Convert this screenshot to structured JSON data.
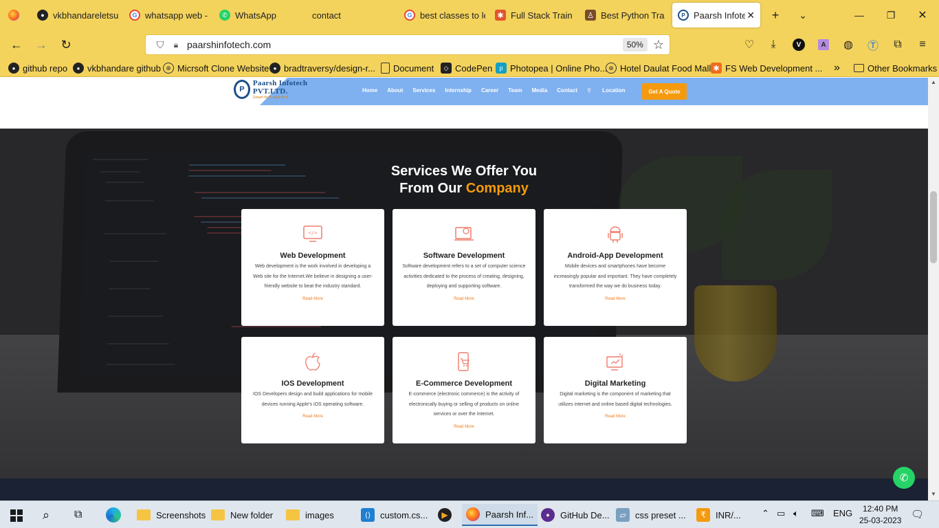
{
  "tabs": [
    {
      "label": "vkbhandareletsup",
      "icon": "github-icon"
    },
    {
      "label": "whatsapp web - G",
      "icon": "google-icon"
    },
    {
      "label": "WhatsApp",
      "icon": "whatsapp-icon"
    },
    {
      "label": "contact",
      "icon": "none"
    },
    {
      "label": "best classes to le",
      "icon": "google-icon"
    },
    {
      "label": "Full Stack Trainin",
      "icon": "fullstack-icon"
    },
    {
      "label": "Best Python Train",
      "icon": "python-icon"
    },
    {
      "label": "Paarsh Infotech",
      "icon": "paarsh-icon"
    }
  ],
  "toolbar": {
    "url": "paarshinfotech.com",
    "zoom": "50%",
    "profile_initial": "V",
    "ext_initial": "A"
  },
  "bookmarks": [
    {
      "label": "github repo",
      "icon": "github-icon"
    },
    {
      "label": "vkbhandare github",
      "icon": "github-icon"
    },
    {
      "label": "Micrsoft Clone Website",
      "icon": "globe-icon"
    },
    {
      "label": "bradtraversy/design-r...",
      "icon": "github-icon"
    },
    {
      "label": "Document",
      "icon": "document-icon"
    },
    {
      "label": "CodePen",
      "icon": "codepen-icon"
    },
    {
      "label": "Photopea | Online Pho...",
      "icon": "photopea-icon"
    },
    {
      "label": "Hotel Daulat Food Mall",
      "icon": "globe-icon"
    },
    {
      "label": "FS Web Development ...",
      "icon": "fs-icon"
    }
  ],
  "other_bookmarks": "Other Bookmarks",
  "site": {
    "logo_name": "Paarsh Infotech PVT.LTD.",
    "logo_tag": "Dream for it, work for it...",
    "menu": [
      "Home",
      "About",
      "Services",
      "Internship",
      "Career",
      "Team",
      "Media",
      "Contact",
      "Location"
    ],
    "quote_button": "Get A Quote"
  },
  "services": {
    "title_line1": "Services We Offer You",
    "title_prefix": "From Our ",
    "title_highlight": "Company",
    "cards": [
      {
        "title": "Web Development",
        "desc": "Web development is the work involved in developing a Web site for the Internet.We believe in designing a user-friendly website to beat the industry standard.",
        "link": "Read More",
        "icon": "web-code-icon"
      },
      {
        "title": "Software Development",
        "desc": "Software development refers to a set of computer science activities dedicated to the process of creating, designing, deploying and supporting software.",
        "link": "Read More",
        "icon": "software-dev-icon"
      },
      {
        "title": "Android-App Development",
        "desc": "Mobile devices and smartphones have become increasingly popular and important. They have completely transformed the way we do business today.",
        "link": "Read More",
        "icon": "android-icon"
      },
      {
        "title": "IOS Development",
        "desc": "IOS Developers design and build applications for mobile devices running Apple's iOS operating software.",
        "link": "Read More",
        "icon": "apple-icon"
      },
      {
        "title": "E-Commerce Development",
        "desc": "E-commerce (electronic commerce) is the activity of electronically buying or selling of products on online services or over the Internet.",
        "link": "Read More",
        "icon": "ecommerce-icon"
      },
      {
        "title": "Digital Marketing",
        "desc": "Digital marketing is the component of marketing that utilizes internet and online based digital technologies.",
        "link": "Read More",
        "icon": "digital-marketing-icon"
      }
    ]
  },
  "taskbar": {
    "items": [
      {
        "label": "Screenshots",
        "icon": "folder-icon"
      },
      {
        "label": "New folder",
        "icon": "folder-icon"
      },
      {
        "label": "images",
        "icon": "folder-icon"
      },
      {
        "label": "custom.cs...",
        "icon": "vscode-icon"
      },
      {
        "label": "",
        "icon": "media-player-icon"
      },
      {
        "label": "Paarsh Inf...",
        "icon": "firefox-icon"
      },
      {
        "label": "GitHub De...",
        "icon": "github-desktop-icon"
      },
      {
        "label": "css preset ...",
        "icon": "css-icon"
      },
      {
        "label": "INR/...",
        "icon": "currency-icon"
      }
    ],
    "lang": "ENG",
    "time": "12:40 PM",
    "date": "25-03-2023"
  },
  "colors": {
    "browser_chrome": "#f4d35c",
    "accent_orange": "#f59a0e",
    "header_blue": "#7fb0ef",
    "whatsapp_green": "#25d366"
  }
}
